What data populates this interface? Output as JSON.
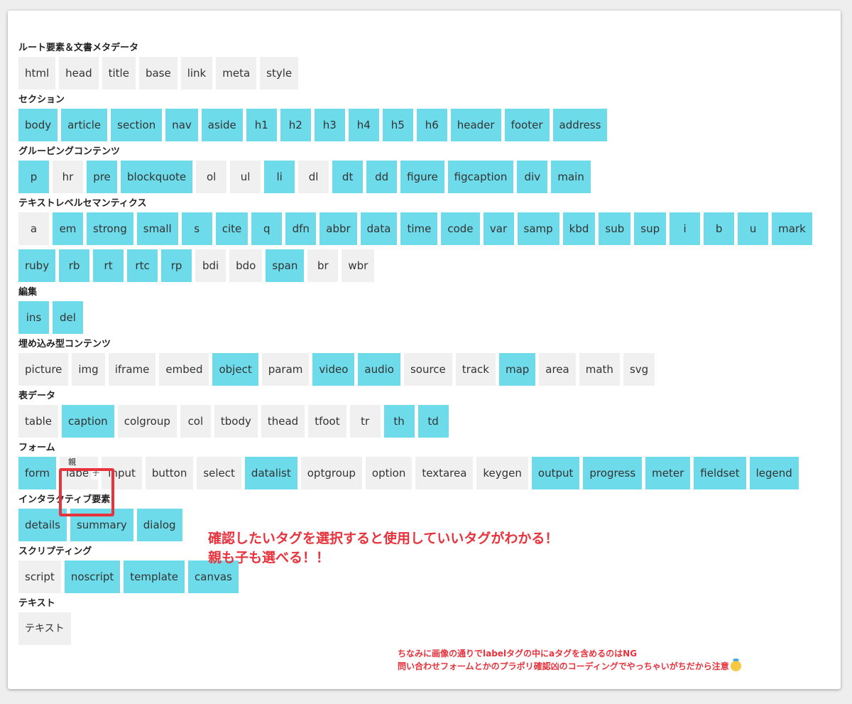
{
  "sections": [
    {
      "title": "ルート要素＆文書メタデータ",
      "tags": [
        {
          "label": "html",
          "on": false
        },
        {
          "label": "head",
          "on": false
        },
        {
          "label": "title",
          "on": false
        },
        {
          "label": "base",
          "on": false
        },
        {
          "label": "link",
          "on": false
        },
        {
          "label": "meta",
          "on": false
        },
        {
          "label": "style",
          "on": false
        }
      ]
    },
    {
      "title": "セクション",
      "tags": [
        {
          "label": "body",
          "on": true
        },
        {
          "label": "article",
          "on": true
        },
        {
          "label": "section",
          "on": true
        },
        {
          "label": "nav",
          "on": true
        },
        {
          "label": "aside",
          "on": true
        },
        {
          "label": "h1",
          "on": true
        },
        {
          "label": "h2",
          "on": true
        },
        {
          "label": "h3",
          "on": true
        },
        {
          "label": "h4",
          "on": true
        },
        {
          "label": "h5",
          "on": true
        },
        {
          "label": "h6",
          "on": true
        },
        {
          "label": "header",
          "on": true
        },
        {
          "label": "footer",
          "on": true
        },
        {
          "label": "address",
          "on": true
        }
      ]
    },
    {
      "title": "グルーピングコンテンツ",
      "tags": [
        {
          "label": "p",
          "on": true
        },
        {
          "label": "hr",
          "on": false
        },
        {
          "label": "pre",
          "on": true
        },
        {
          "label": "blockquote",
          "on": true
        },
        {
          "label": "ol",
          "on": false
        },
        {
          "label": "ul",
          "on": false
        },
        {
          "label": "li",
          "on": true
        },
        {
          "label": "dl",
          "on": false
        },
        {
          "label": "dt",
          "on": true
        },
        {
          "label": "dd",
          "on": true
        },
        {
          "label": "figure",
          "on": true
        },
        {
          "label": "figcaption",
          "on": true
        },
        {
          "label": "div",
          "on": true
        },
        {
          "label": "main",
          "on": true
        }
      ]
    },
    {
      "title": "テキストレベルセマンティクス",
      "tags": [
        {
          "label": "a",
          "on": false
        },
        {
          "label": "em",
          "on": true
        },
        {
          "label": "strong",
          "on": true
        },
        {
          "label": "small",
          "on": true
        },
        {
          "label": "s",
          "on": true
        },
        {
          "label": "cite",
          "on": true
        },
        {
          "label": "q",
          "on": true
        },
        {
          "label": "dfn",
          "on": true
        },
        {
          "label": "abbr",
          "on": true
        },
        {
          "label": "data",
          "on": true
        },
        {
          "label": "time",
          "on": true
        },
        {
          "label": "code",
          "on": true
        },
        {
          "label": "var",
          "on": true
        },
        {
          "label": "samp",
          "on": true
        },
        {
          "label": "kbd",
          "on": true
        },
        {
          "label": "sub",
          "on": true
        },
        {
          "label": "sup",
          "on": true
        },
        {
          "label": "i",
          "on": true
        },
        {
          "label": "b",
          "on": true
        },
        {
          "label": "u",
          "on": true
        },
        {
          "label": "mark",
          "on": true
        },
        {
          "label": "ruby",
          "on": true
        },
        {
          "label": "rb",
          "on": true
        },
        {
          "label": "rt",
          "on": true
        },
        {
          "label": "rtc",
          "on": true
        },
        {
          "label": "rp",
          "on": true
        },
        {
          "label": "bdi",
          "on": false
        },
        {
          "label": "bdo",
          "on": false
        },
        {
          "label": "span",
          "on": true
        },
        {
          "label": "br",
          "on": false
        },
        {
          "label": "wbr",
          "on": false
        }
      ]
    },
    {
      "title": "編集",
      "tags": [
        {
          "label": "ins",
          "on": true
        },
        {
          "label": "del",
          "on": true
        }
      ]
    },
    {
      "title": "埋め込み型コンテンツ",
      "tags": [
        {
          "label": "picture",
          "on": false
        },
        {
          "label": "img",
          "on": false
        },
        {
          "label": "iframe",
          "on": false
        },
        {
          "label": "embed",
          "on": false
        },
        {
          "label": "object",
          "on": true
        },
        {
          "label": "param",
          "on": false
        },
        {
          "label": "video",
          "on": true
        },
        {
          "label": "audio",
          "on": true
        },
        {
          "label": "source",
          "on": false
        },
        {
          "label": "track",
          "on": false
        },
        {
          "label": "map",
          "on": true
        },
        {
          "label": "area",
          "on": false
        },
        {
          "label": "math",
          "on": false
        },
        {
          "label": "svg",
          "on": false
        }
      ]
    },
    {
      "title": "表データ",
      "tags": [
        {
          "label": "table",
          "on": false
        },
        {
          "label": "caption",
          "on": true
        },
        {
          "label": "colgroup",
          "on": false
        },
        {
          "label": "col",
          "on": false
        },
        {
          "label": "tbody",
          "on": false
        },
        {
          "label": "thead",
          "on": false
        },
        {
          "label": "tfoot",
          "on": false
        },
        {
          "label": "tr",
          "on": false
        },
        {
          "label": "th",
          "on": true
        },
        {
          "label": "td",
          "on": true
        }
      ]
    },
    {
      "title": "フォーム",
      "tags": [
        {
          "label": "form",
          "on": true
        },
        {
          "label": "label",
          "on": false,
          "parent_mark": "親",
          "child_mark": "子"
        },
        {
          "label": "input",
          "on": false
        },
        {
          "label": "button",
          "on": false
        },
        {
          "label": "select",
          "on": false
        },
        {
          "label": "datalist",
          "on": true
        },
        {
          "label": "optgroup",
          "on": false
        },
        {
          "label": "option",
          "on": false
        },
        {
          "label": "textarea",
          "on": false
        },
        {
          "label": "keygen",
          "on": false
        },
        {
          "label": "output",
          "on": true
        },
        {
          "label": "progress",
          "on": true
        },
        {
          "label": "meter",
          "on": true
        },
        {
          "label": "fieldset",
          "on": true
        },
        {
          "label": "legend",
          "on": true
        }
      ]
    },
    {
      "title": "インタラクティブ要素",
      "tags": [
        {
          "label": "details",
          "on": true
        },
        {
          "label": "summary",
          "on": true
        },
        {
          "label": "dialog",
          "on": true
        }
      ]
    },
    {
      "title": "スクリプティング",
      "tags": [
        {
          "label": "script",
          "on": false
        },
        {
          "label": "noscript",
          "on": true
        },
        {
          "label": "template",
          "on": true
        },
        {
          "label": "canvas",
          "on": true
        }
      ]
    },
    {
      "title": "テキスト",
      "tags": [
        {
          "label": "テキスト",
          "on": false,
          "jp": true
        }
      ]
    }
  ],
  "annotations": {
    "big_line1": "確認したいタグを選択すると使用していいタグがわかる！",
    "big_line2": "親も子も選べる！！",
    "small_line1": "ちなみに画像の通りでlabelタグの中にaタグを含めるのはNG",
    "small_line2": "問い合わせフォームとかのプラポリ確認凶のコーディングでやっちゃいがちだから注意",
    "emoji_icon": "smiling-face-with-halo-icon"
  },
  "colors": {
    "selected": "#6ddbea",
    "unselected": "#f0f0f0",
    "annotation_red": "#e8323c"
  }
}
